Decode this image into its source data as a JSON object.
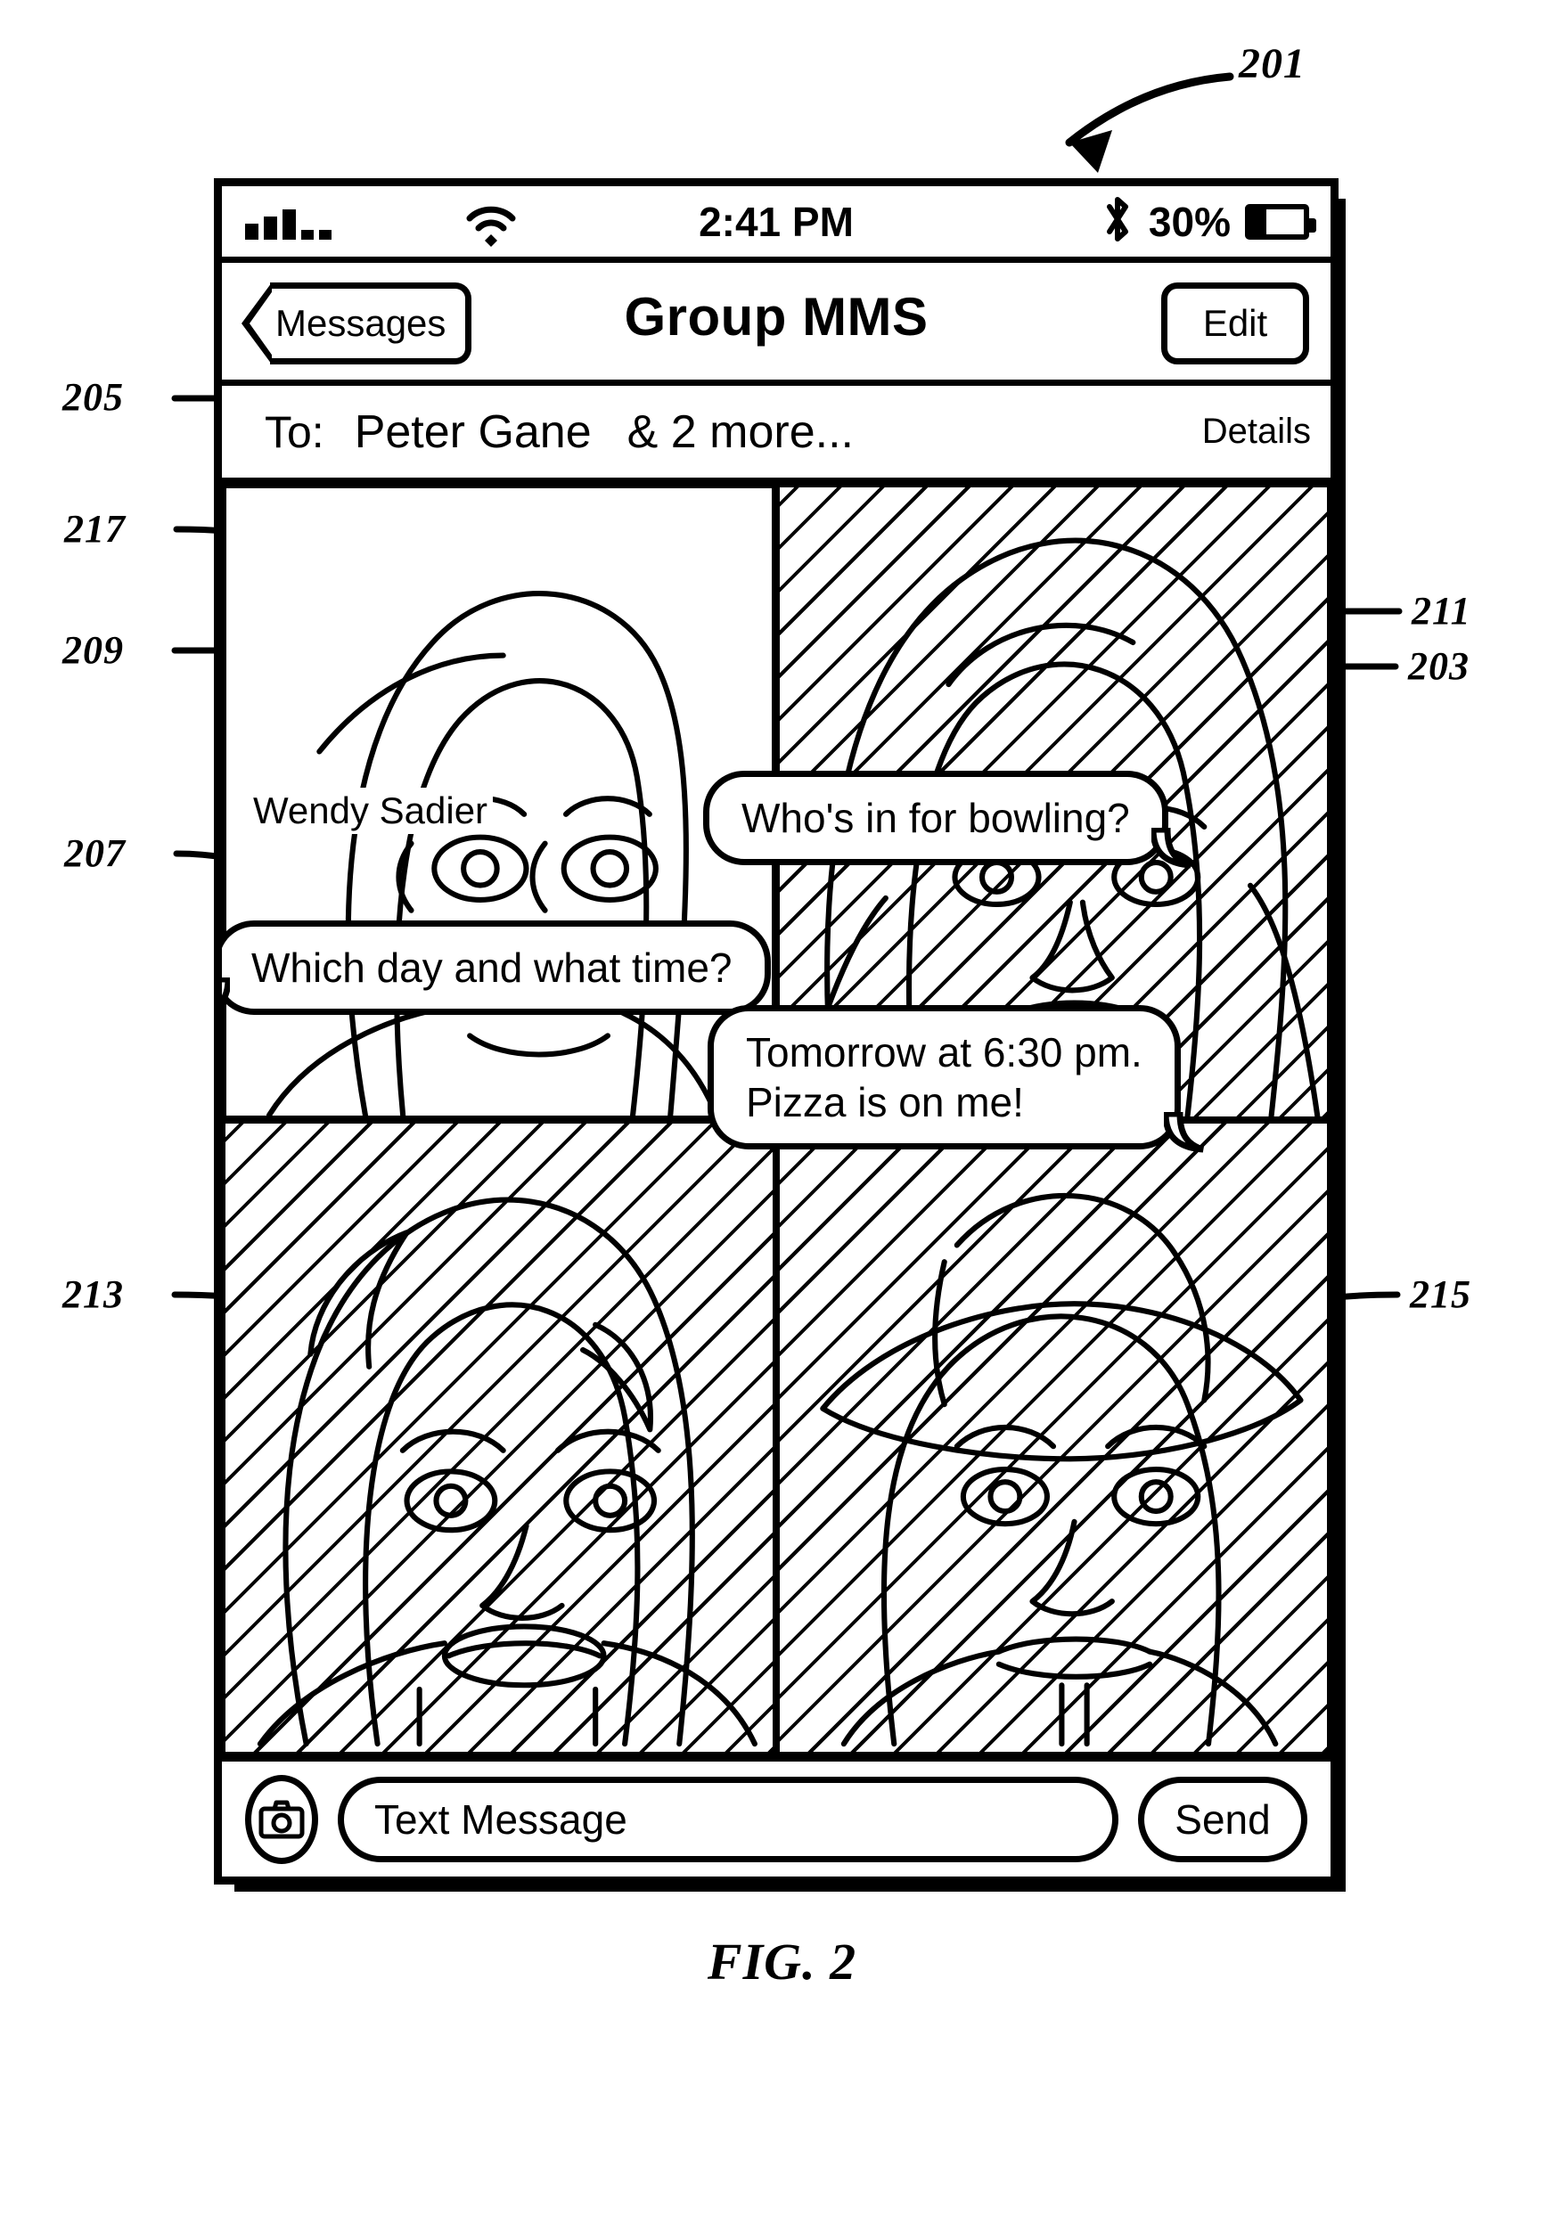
{
  "figure": {
    "caption": "FIG. 2",
    "device_ref": "201",
    "refs": {
      "device": "201",
      "conversation_area": "203",
      "to_field_name": "205",
      "participant_name_label": "207",
      "selected_participant_image": "209",
      "participant_image_top_right": "211",
      "participant_image_bottom_left": "213",
      "participant_image_bottom_right": "215",
      "selection_highlight_border": "217"
    }
  },
  "status_bar": {
    "signal_icon": "cellular-signal-icon",
    "wifi_icon": "wifi-icon",
    "time": "2:41 PM",
    "bluetooth_icon": "bluetooth-icon",
    "battery_percent": "30%",
    "battery_level": 30,
    "battery_icon": "battery-icon"
  },
  "nav_bar": {
    "back_label": "Messages",
    "back_icon": "chevron-left-icon",
    "title": "Group MMS",
    "edit_label": "Edit"
  },
  "recipients": {
    "to_label": "To:",
    "primary_name": "Peter Gane",
    "more_text": "& 2 more...",
    "details_label": "Details"
  },
  "participants": [
    {
      "id": "209",
      "position": "top-left",
      "name": "Wendy Sadier",
      "selected": true,
      "shaded": false,
      "avatar_icon": "face-short-hair-icon"
    },
    {
      "id": "211",
      "position": "top-right",
      "name": "",
      "selected": false,
      "shaded": true,
      "avatar_icon": "face-long-hair-icon"
    },
    {
      "id": "213",
      "position": "bottom-left",
      "name": "",
      "selected": false,
      "shaded": true,
      "avatar_icon": "face-wavy-hair-icon"
    },
    {
      "id": "215",
      "position": "bottom-right",
      "name": "",
      "selected": false,
      "shaded": true,
      "avatar_icon": "face-with-hat-icon"
    }
  ],
  "messages": [
    {
      "id": "msg-bowling",
      "text": "Who's in for bowling?",
      "align": "right"
    },
    {
      "id": "msg-whichday",
      "text": "Which day and what time?",
      "align": "left"
    },
    {
      "id": "msg-tomorrow",
      "line1": "Tomorrow at 6:30 pm.",
      "line2": "Pizza is on me!",
      "align": "right"
    }
  ],
  "toolbar": {
    "camera_icon": "camera-icon",
    "input_placeholder": "Text Message",
    "input_value": "",
    "send_label": "Send"
  },
  "colors": {
    "ink": "#000000",
    "paper": "#ffffff"
  }
}
